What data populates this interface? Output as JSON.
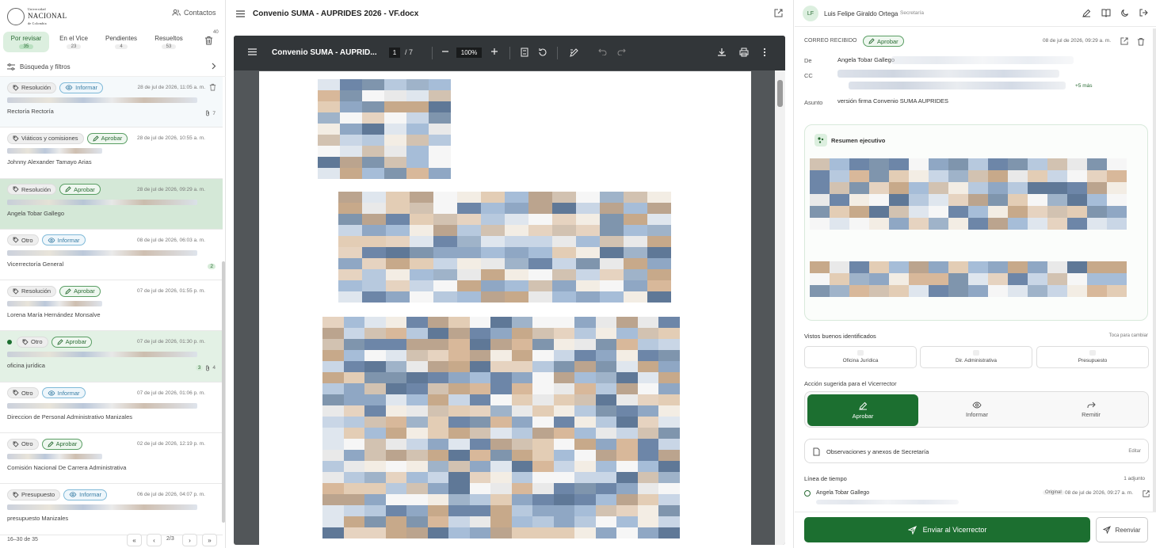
{
  "app": {
    "logo_text_1": "Universidad",
    "logo_text_2": "NACIONAL",
    "logo_text_3": "de Colombia",
    "contacts_label": "Contactos"
  },
  "tabs": [
    {
      "label": "Por revisar",
      "count": "35"
    },
    {
      "label": "En el Vice",
      "count": "23"
    },
    {
      "label": "Pendientes",
      "count": "4"
    },
    {
      "label": "Resueltos",
      "count": "53"
    }
  ],
  "trash_badge": "40",
  "filter_label": "Búsqueda y filtros",
  "mails": [
    {
      "category": "Resolución",
      "action": "Informar",
      "action_type": "informar",
      "date": "28 de jul de 2026, 11:05 a. m.",
      "sender": "Rectoría Rectoría",
      "count": "7",
      "state": "light"
    },
    {
      "category": "Viáticos y comisiones",
      "action": "Aprobar",
      "action_type": "aprobar",
      "date": "28 de jul de 2026, 10:55 a. m.",
      "sender": "Johnny Alexander Tamayo Arias",
      "count": "",
      "state": ""
    },
    {
      "category": "Resolución",
      "action": "Aprobar",
      "action_type": "aprobar",
      "date": "28 de jul de 2026, 09:29 a. m.",
      "sender": "Angela Tobar Gallego",
      "count": "",
      "state": "sel"
    },
    {
      "category": "Otro",
      "action": "Informar",
      "action_type": "informar",
      "date": "08 de jul de 2026, 06:03 a. m.",
      "sender": "Vicerrectoría General",
      "count": "2",
      "state": ""
    },
    {
      "category": "Resolución",
      "action": "Aprobar",
      "action_type": "aprobar",
      "date": "07 de jul de 2026, 01:55 p. m.",
      "sender": "Lorena María Hernández Monsalve",
      "count": "",
      "state": ""
    },
    {
      "category": "Otro",
      "action": "Aprobar",
      "action_type": "aprobar",
      "date": "07 de jul de 2026, 01:30 p. m.",
      "sender": "oficina jurídica",
      "count": "3",
      "count2": "4",
      "state": "green2"
    },
    {
      "category": "Otro",
      "action": "Informar",
      "action_type": "informar",
      "date": "07 de jul de 2026, 01:06 p. m.",
      "sender": "Direccion de Personal Administrativo Manizales",
      "count": "",
      "state": ""
    },
    {
      "category": "Otro",
      "action": "Aprobar",
      "action_type": "aprobar",
      "date": "02 de jul de 2026, 12:19 p. m.",
      "sender": "Comisión Nacional De Carrera Administrativa",
      "count": "",
      "state": ""
    },
    {
      "category": "Presupuesto",
      "action": "Informar",
      "action_type": "informar",
      "date": "06 de jul de 2026, 04:07 p. m.",
      "sender": "presupuesto Manizales",
      "count": "",
      "state": ""
    }
  ],
  "pager": {
    "range": "16–30 de 35",
    "page": "2/3"
  },
  "document": {
    "title": "Convenio SUMA - AUPRIDES 2026 - VF.docx",
    "viewer_name": "Convenio SUMA - AUPRID...",
    "page": "1",
    "pages": "7",
    "zoom": "100%"
  },
  "user": {
    "initials": "LF",
    "name": "Luis Felipe Giraldo Ortega",
    "role": "Secretaría"
  },
  "email": {
    "section_label": "CORREO RECIBIDO",
    "status": "Aprobar",
    "date": "08 de jul de 2026, 09:29 a. m.",
    "from_label": "De",
    "from_value": "Angela Tobar Gallego",
    "cc_label": "CC",
    "cc_more": "+5 más",
    "subject_label": "Asunto",
    "subject_value": "versión firma Convenio SUMA AUPRIDES"
  },
  "summary": {
    "title": "Resumen ejecutivo"
  },
  "vistos": {
    "heading": "Vistos buenos identificados",
    "link": "Toca para cambiar",
    "items": [
      "Oficina Jurídica",
      "Dir. Administrativa",
      "Presupuesto"
    ]
  },
  "suggested": {
    "heading": "Acción sugerida para el Vicerrector",
    "options": [
      "Aprobar",
      "Informar",
      "Remitir"
    ]
  },
  "observaciones": {
    "label": "Observaciones y anexos de Secretaría",
    "edit": "Editar"
  },
  "timeline": {
    "heading": "Línea de tiempo",
    "attachments": "1 adjunto",
    "entry_name": "Angela Tobar Gallego",
    "entry_tag": "Original",
    "entry_date": "08 de jul de 2026, 09:27 a. m."
  },
  "footer": {
    "send_label": "Enviar al Vicerrector",
    "resend_label": "Reenviar"
  }
}
